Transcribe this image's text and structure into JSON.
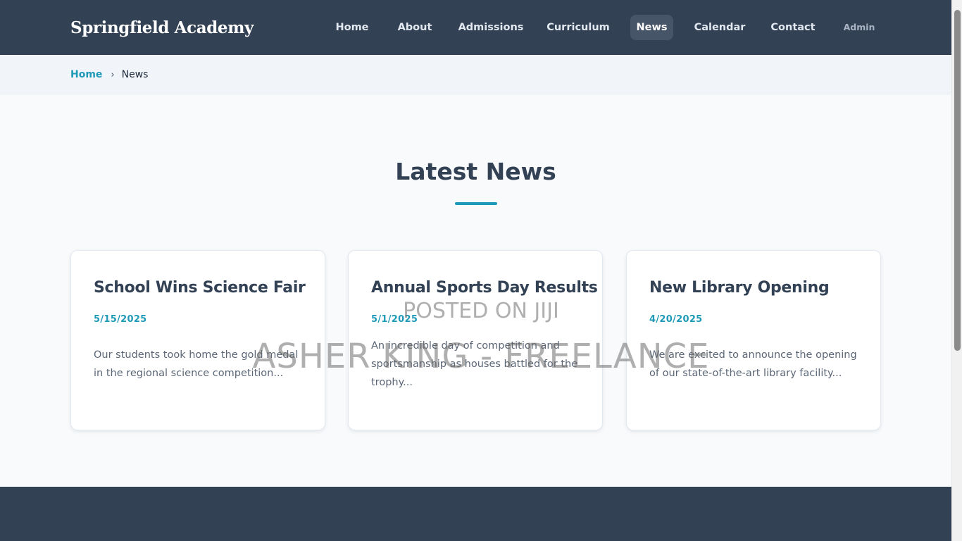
{
  "header": {
    "brand": "Springfield Academy",
    "nav": [
      {
        "label": "Home"
      },
      {
        "label": "About"
      },
      {
        "label": "Admissions"
      },
      {
        "label": "Curriculum"
      },
      {
        "label": "News",
        "active": true
      },
      {
        "label": "Calendar"
      },
      {
        "label": "Contact"
      },
      {
        "label": "Admin"
      }
    ]
  },
  "breadcrumb": {
    "home": "Home",
    "separator": "›",
    "current": "News"
  },
  "section": {
    "title": "Latest News"
  },
  "cards": [
    {
      "title": "School Wins Science Fair",
      "date": "5/15/2025",
      "excerpt": "Our students took home the gold medal in the regional science competition..."
    },
    {
      "title": "Annual Sports Day Results",
      "date": "5/1/2025",
      "excerpt": "An incredible day of competition and sportsmanship as houses battled for the trophy..."
    },
    {
      "title": "New Library Opening",
      "date": "4/20/2025",
      "excerpt": "We are excited to announce the opening of our state-of-the-art library facility..."
    }
  ],
  "watermark": {
    "line1": "POSTED ON JIJI",
    "line2": "ASHER KING - FREELANCE"
  },
  "colors": {
    "header_bg": "#334155",
    "accent": "#1e9ab8",
    "page_bg": "#f8fafc",
    "active_nav_bg": "#475569"
  }
}
